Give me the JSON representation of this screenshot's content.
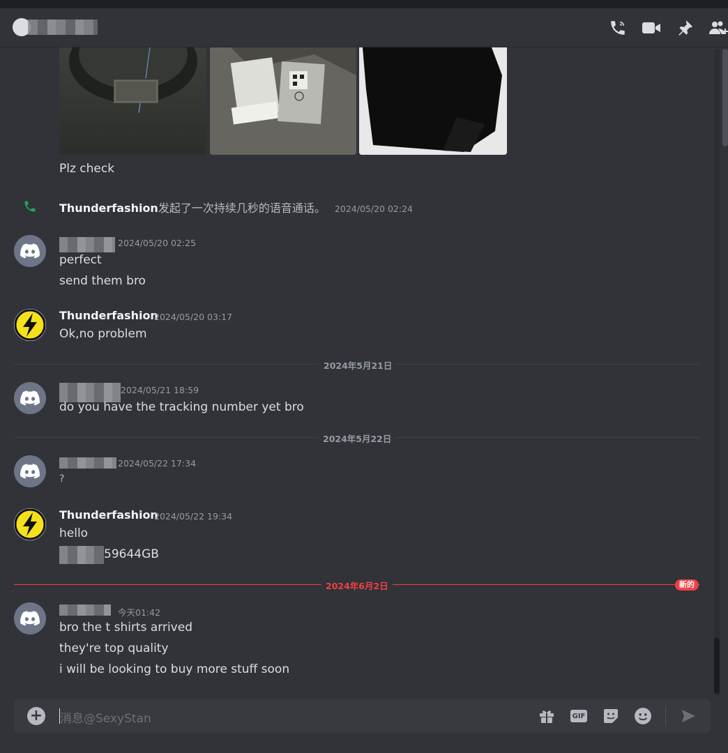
{
  "header": {
    "channel_name": "",
    "icons": [
      "voice-call-icon",
      "video-call-icon",
      "pin-icon",
      "add-friend-icon"
    ]
  },
  "attachments": [
    "tshirt-collar-photo",
    "tshirt-label-photo",
    "tshirt-folded-photo"
  ],
  "messages": {
    "m0": {
      "line1": "Plz check"
    },
    "call": {
      "author": "Thunderfashion",
      "text": "发起了一次持续几秒的语音通话。",
      "timestamp": "2024/05/20 02:24"
    },
    "m1": {
      "timestamp": "2024/05/20 02:25",
      "line1": "perfect",
      "line2": "send them bro"
    },
    "m2": {
      "author": "Thunderfashion",
      "timestamp": "2024/05/20 03:17",
      "line1": "Ok,no problem"
    },
    "m3": {
      "timestamp": "2024/05/21 18:59",
      "line1": "do you have the tracking number yet bro"
    },
    "m4": {
      "timestamp": "2024/05/22 17:34",
      "line1": "?"
    },
    "m5": {
      "author": "Thunderfashion",
      "timestamp": "2024/05/22 19:34",
      "line1": "hello",
      "line2": "59644GB"
    },
    "m6": {
      "timestamp": "今天01:42",
      "line1": "bro the t shirts arrived",
      "line2": "they're top quality",
      "line3": "i will be looking to buy more stuff soon"
    }
  },
  "dividers": {
    "d1": "2024年5月21日",
    "d2": "2024年5月22日",
    "d3": "2024年6月2日",
    "new_badge": "新的"
  },
  "composer": {
    "placeholder": "消息@SexyStan",
    "gif_label": "GIF",
    "icons": [
      "gift-icon",
      "gif-icon",
      "sticker-icon",
      "emoji-icon",
      "send-icon"
    ]
  },
  "colors": {
    "accent_new": "#f23f43",
    "background": "#313338",
    "call_green": "#23a55a",
    "bolt_yellow": "#f5e11b"
  }
}
